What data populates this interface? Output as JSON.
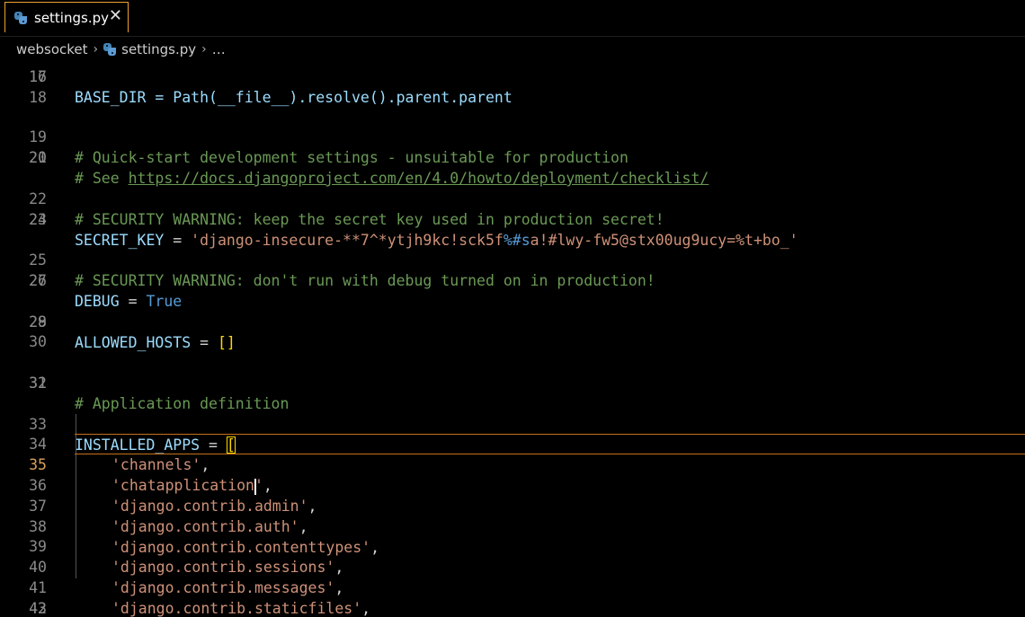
{
  "tab": {
    "label": "settings.py",
    "close": "✕"
  },
  "breadcrumb": {
    "folder": "websocket",
    "sep1": "›",
    "file": "settings.py",
    "sep2": "›",
    "more": "…"
  },
  "lines": {
    "l16": {
      "num": "16",
      "text": "BASE_DIR = Path(__file__).resolve().parent.parent"
    },
    "l17": {
      "num": "17"
    },
    "l18": {
      "num": "18"
    },
    "l19": {
      "num": "19",
      "comment": "# Quick-start development settings - unsuitable for production"
    },
    "l20": {
      "num": "20",
      "prefix": "# See ",
      "url": "https://docs.djangoproject.com/en/4.0/howto/deployment/checklist/"
    },
    "l21": {
      "num": "21"
    },
    "l22": {
      "num": "22",
      "comment": "# SECURITY WARNING: keep the secret key used in production secret!"
    },
    "l23": {
      "num": "23",
      "var": "SECRET_KEY",
      "op": " = ",
      "str_a": "'django-insecure-**7^*ytjh9kc!sck5f",
      "esc": "%#s",
      "str_b": "a!#lwy-fw5@stx00ug9ucy=%t+bo_'"
    },
    "l24": {
      "num": "24"
    },
    "l25": {
      "num": "25",
      "comment": "# SECURITY WARNING: don't run with debug turned on in production!"
    },
    "l26": {
      "num": "26",
      "var": "DEBUG",
      "op": " = ",
      "value": "True"
    },
    "l27": {
      "num": "27"
    },
    "l28": {
      "num": "28",
      "var": "ALLOWED_HOSTS",
      "op": " = ",
      "value": "[]"
    },
    "l29": {
      "num": "29"
    },
    "l30": {
      "num": "30"
    },
    "l31": {
      "num": "31",
      "comment": "# Application definition"
    },
    "l32": {
      "num": "32"
    },
    "l33": {
      "num": "33",
      "var": "INSTALLED_APPS",
      "op": " = ",
      "bracket": "["
    },
    "l34": {
      "num": "34",
      "str": "'channels'",
      "tail": ","
    },
    "l35": {
      "num": "35",
      "str_a": "'chatapplication",
      "str_b": "'",
      "tail": ","
    },
    "l36": {
      "num": "36",
      "str": "'django.contrib.admin'",
      "tail": ","
    },
    "l37": {
      "num": "37",
      "str": "'django.contrib.auth'",
      "tail": ","
    },
    "l38": {
      "num": "38",
      "str": "'django.contrib.contenttypes'",
      "tail": ","
    },
    "l39": {
      "num": "39",
      "str": "'django.contrib.sessions'",
      "tail": ","
    },
    "l40": {
      "num": "40",
      "str": "'django.contrib.messages'",
      "tail": ","
    },
    "l41": {
      "num": "41",
      "str": "'django.contrib.staticfiles'",
      "tail": ","
    },
    "l42": {
      "num": "42",
      "bracket": "]"
    },
    "l43": {
      "num": "43"
    }
  },
  "colors": {
    "comment": "#6a9955",
    "variable": "#9cdcfe",
    "string": "#ce9178",
    "keyword": "#569cd6",
    "bracket": "#ffd700",
    "tab_border": "#f0a030"
  },
  "icons": {
    "file_icon": "python-icon",
    "close_icon": "close-icon"
  }
}
